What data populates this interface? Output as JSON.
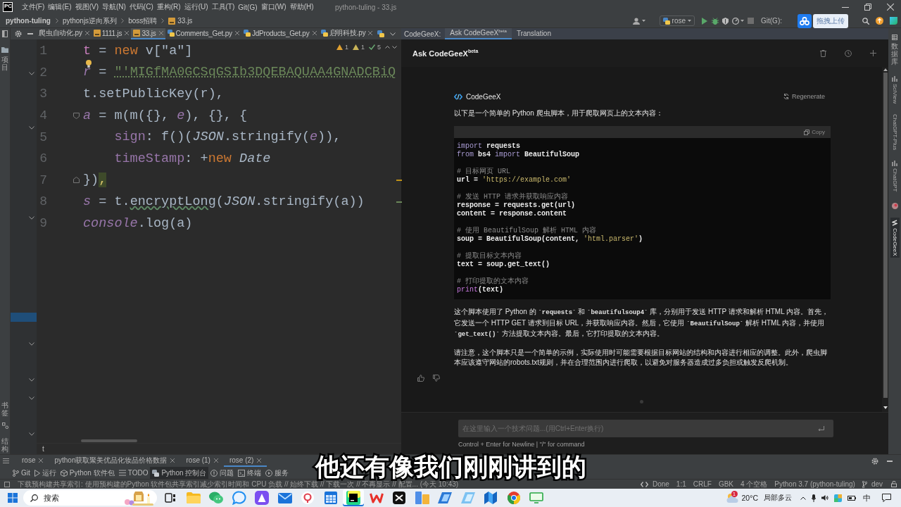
{
  "window": {
    "logo": "PC",
    "menu": [
      "文件(F)",
      "编辑(E)",
      "视图(V)",
      "导航(N)",
      "代码(C)",
      "重构(R)",
      "运行(U)",
      "工具(T)",
      "Git(G)",
      "窗口(W)",
      "帮助(H)"
    ],
    "title": "python-tuling - 33.js"
  },
  "navbar": {
    "breadcrumb": [
      {
        "kind": "project",
        "text": "python-tuling"
      },
      {
        "kind": "folder",
        "text": "pythonjs逆向系列"
      },
      {
        "kind": "folder",
        "text": "boss招聘"
      },
      {
        "kind": "file",
        "text": "33.js"
      }
    ],
    "run_config": "rose",
    "git_label": "Git(G):",
    "upload_widget": "拖拽上传"
  },
  "left_strip": {
    "top": [
      "项目"
    ],
    "bottom": [
      "书签",
      "结构"
    ]
  },
  "project_tree": [
    {
      "kind": "folder",
      "selected": false
    },
    {
      "kind": "folder",
      "selected": false
    },
    {
      "kind": "folder",
      "selected": false
    },
    {
      "kind": "file",
      "selected": true
    },
    {
      "kind": "folder",
      "selected": false
    },
    {
      "kind": "folder",
      "selected": false
    },
    {
      "kind": "folder",
      "selected": false
    },
    {
      "kind": "folder",
      "selected": false
    }
  ],
  "editor_tabs": [
    {
      "kind": "plain",
      "label": "爬虫自动化.py",
      "selected": false
    },
    {
      "kind": "js",
      "label": "1111.js",
      "selected": false
    },
    {
      "kind": "js",
      "label": "33.js",
      "selected": true
    },
    {
      "kind": "py",
      "label": "Comments_Get.py",
      "selected": false
    },
    {
      "kind": "py",
      "label": "JdProducts_Get.py",
      "selected": false
    },
    {
      "kind": "py",
      "label": "启明科技.py",
      "selected": false
    }
  ],
  "editor": {
    "inspections": [
      {
        "kind": "warning",
        "count": "1"
      },
      {
        "kind": "weak_warning",
        "count": "1"
      },
      {
        "kind": "typo",
        "count": "5"
      }
    ],
    "lines": [
      {
        "kind": "plain",
        "number": "1",
        "intention": false,
        "tokens": [
          {
            "kind": "var",
            "text": "t"
          },
          {
            "kind": "plain",
            "text": " = "
          },
          {
            "kind": "kw",
            "text": "new"
          },
          {
            "kind": "plain",
            "text": " v[\"a\"]"
          }
        ]
      },
      {
        "kind": "plain",
        "number": "2",
        "intention": true,
        "tokens": [
          {
            "kind": "ivar",
            "text": "r"
          },
          {
            "kind": "plain",
            "text": " = "
          },
          {
            "kind": "strtypo",
            "text": "\"'MIGfMA0GCSqGSIb3DQEBAQUAA4GNADCBiQ"
          }
        ]
      },
      {
        "kind": "plain",
        "number": "3",
        "intention": false,
        "tokens": [
          {
            "kind": "plain",
            "text": "t.setPublicKey(r),"
          }
        ]
      },
      {
        "kind": "fold_start",
        "number": "4",
        "intention": false,
        "tokens": [
          {
            "kind": "ivar",
            "text": "a"
          },
          {
            "kind": "plain",
            "text": " = m(m({}, "
          },
          {
            "kind": "ivar",
            "text": "e"
          },
          {
            "kind": "plain",
            "text": "), {}, {"
          }
        ]
      },
      {
        "kind": "plain",
        "number": "5",
        "intention": false,
        "tokens": [
          {
            "kind": "prop",
            "text": "    sign"
          },
          {
            "kind": "plain",
            "text": ": f()("
          },
          {
            "kind": "ital",
            "text": "JSON"
          },
          {
            "kind": "plain",
            "text": ".stringify("
          },
          {
            "kind": "ivar",
            "text": "e"
          },
          {
            "kind": "plain",
            "text": ")),"
          }
        ]
      },
      {
        "kind": "plain",
        "number": "6",
        "intention": false,
        "tokens": [
          {
            "kind": "prop",
            "text": "    timeStamp"
          },
          {
            "kind": "plain",
            "text": ": +"
          },
          {
            "kind": "kw",
            "text": "new"
          },
          {
            "kind": "ital",
            "text": " Date"
          }
        ]
      },
      {
        "kind": "fold_end",
        "number": "7",
        "intention": false,
        "tokens": [
          {
            "kind": "plain",
            "text": "})"
          },
          {
            "kind": "match",
            "text": ","
          }
        ]
      },
      {
        "kind": "plain",
        "number": "8",
        "intention": false,
        "tokens": [
          {
            "kind": "ivar",
            "text": "s"
          },
          {
            "kind": "plain",
            "text": " = t."
          },
          {
            "kind": "typo",
            "text": "encryptLong"
          },
          {
            "kind": "plain",
            "text": "("
          },
          {
            "kind": "ital",
            "text": "JSON"
          },
          {
            "kind": "plain",
            "text": ".stringify(a))"
          }
        ]
      },
      {
        "kind": "plain",
        "number": "9",
        "intention": false,
        "tokens": [
          {
            "kind": "ivar",
            "text": "console"
          },
          {
            "kind": "plain",
            "text": ".log(a)"
          }
        ]
      }
    ],
    "error_stripe": [
      {
        "kind": "warning"
      },
      {
        "kind": "typo"
      }
    ],
    "breadcrumb": "t"
  },
  "panel": {
    "title": "CodeGeeX:",
    "tabs": [
      {
        "label": "Ask CodeGeeX$^{beta}$",
        "selected": true
      },
      {
        "label": "Translation",
        "selected": false
      }
    ]
  },
  "assistant": {
    "title": "Ask CodeGeeX$^{beta}$",
    "bot_name": "CodeGeeX",
    "regenerate": "Regenerate",
    "intro": "以下是一个简单的 Python 爬虫脚本，用于爬取网页上的文本内容：",
    "copy": "Copy",
    "code": [
      [
        [
          {
            "kind": "kw",
            "text": "import"
          },
          {
            "kind": "name",
            "text": " requests"
          }
        ],
        [
          {
            "kind": "kw",
            "text": "from"
          },
          {
            "kind": "name",
            "text": " bs4 "
          },
          {
            "kind": "kw",
            "text": "import"
          },
          {
            "kind": "name",
            "text": " BeautifulSoup"
          }
        ]
      ],
      [
        [
          {
            "kind": "com",
            "text": "# 目标网页 URL"
          }
        ],
        [
          {
            "kind": "name",
            "text": "url = "
          },
          {
            "kind": "str",
            "text": "'https://example.com'"
          }
        ]
      ],
      [
        [
          {
            "kind": "com",
            "text": "# 发送 HTTP 请求并获取响应内容"
          }
        ],
        [
          {
            "kind": "name",
            "text": "response = requests.get(url)"
          }
        ],
        [
          {
            "kind": "name",
            "text": "content = response.content"
          }
        ]
      ],
      [
        [
          {
            "kind": "com",
            "text": "# 使用 BeautifulSoup 解析 HTML 内容"
          }
        ],
        [
          {
            "kind": "name",
            "text": "soup = BeautifulSoup(content, "
          },
          {
            "kind": "str",
            "text": "'html.parser'"
          },
          {
            "kind": "name",
            "text": ")"
          }
        ]
      ],
      [
        [
          {
            "kind": "com",
            "text": "# 提取目标文本内容"
          }
        ],
        [
          {
            "kind": "name",
            "text": "text = soup.get_text()"
          }
        ]
      ],
      [
        [
          {
            "kind": "com",
            "text": "# 打印提取的文本内容"
          }
        ],
        [
          {
            "kind": "fn",
            "text": "print"
          },
          {
            "kind": "name",
            "text": "(text)"
          }
        ]
      ]
    ],
    "paragraphs": [
      "这个脚本使用了 Python 的 **`requests`** 和 **`beautifulsoup4`** 库，分别用于发送 HTTP 请求和解析 HTML 内容。首先，它发送一个 HTTP GET 请求到目标 URL，并获取响应内容。然后，它使用 **`BeautifulSoup`** 解析 HTML 内容，并使用 **`get_text()`** 方法提取文本内容。最后，它打印提取的文本内容。",
      "请注意，这个脚本只是一个简单的示例，实际使用时可能需要根据目标网站的结构和内容进行相应的调整。此外，爬虫脚本应该遵守网站的robots.txt规则，并在合理范围内进行爬取，以避免对服务器造成过多负担或触发反爬机制。"
    ],
    "input_placeholder": "在这里输入一个技术问题...(用Ctrl+Enter换行)",
    "input_hint": "Control + Enter for Newline | \"/\" for command"
  },
  "right_strip": [
    {
      "kind": "database",
      "label": "数据库",
      "stacked": true,
      "selected": false
    },
    {
      "kind": "bars",
      "label": "SciView",
      "stacked": false,
      "selected": false
    },
    {
      "kind": "plain",
      "label": "ChatGPT-Plus",
      "stacked": false,
      "selected": false
    },
    {
      "kind": "bars",
      "label": "ChatGPT",
      "stacked": false,
      "selected": false
    },
    {
      "kind": "red_badge",
      "selected": false
    },
    {
      "kind": "codegeex",
      "label": "CodeGeeX",
      "stacked": false,
      "selected": true
    }
  ],
  "run_tabs": [
    {
      "label": "rose",
      "selected": false
    },
    {
      "label": "python获取聚美优品化妆品价格数据",
      "selected": false
    },
    {
      "label": "rose (1)",
      "selected": false
    },
    {
      "label": "rose (2)",
      "selected": true
    }
  ],
  "tool_windows": [
    {
      "kind": "git",
      "label": "Git",
      "selected": false
    },
    {
      "kind": "run",
      "label": "运行",
      "selected": false
    },
    {
      "kind": "packages",
      "label": "Python 软件包",
      "selected": false
    },
    {
      "kind": "todo",
      "label": "TODO",
      "selected": false
    },
    {
      "kind": "console",
      "label": "Python 控制台",
      "selected": true
    },
    {
      "kind": "problems",
      "label": "问题",
      "selected": false
    },
    {
      "kind": "terminal",
      "label": "终端",
      "selected": false
    },
    {
      "kind": "services",
      "label": "服务",
      "selected": false
    }
  ],
  "status_bar": {
    "message": "下载预构建共享索引: 使用预构建的Python 软件包共享索引减少索引时间和 CPU 负载 // 始终下载 // 下载一次 // 不再显示 // 配置... (今天 10:43)",
    "items": [
      {
        "kind": "codegeex",
        "text": "Done"
      },
      {
        "kind": "plain",
        "text": "1:1"
      },
      {
        "kind": "plain",
        "text": "CRLF"
      },
      {
        "kind": "plain",
        "text": "GBK"
      },
      {
        "kind": "plain",
        "text": "4 个空格"
      },
      {
        "kind": "plain",
        "text": "Python 3.7 (python-tuling)"
      },
      {
        "kind": "branch",
        "text": "dev"
      }
    ]
  },
  "taskbar": {
    "search_placeholder": "搜索",
    "apps": [
      {
        "kind": "taskview",
        "active": false
      },
      {
        "kind": "folder",
        "active": false
      },
      {
        "kind": "wechat",
        "active": false
      },
      {
        "kind": "chat",
        "active": false
      },
      {
        "kind": "triangle",
        "active": false
      },
      {
        "kind": "mail",
        "active": false
      },
      {
        "kind": "ring",
        "active": false
      },
      {
        "kind": "calendar",
        "active": false
      },
      {
        "kind": "ide",
        "active": true
      },
      {
        "kind": "zigzag",
        "active": false
      },
      {
        "kind": "cross",
        "active": false
      },
      {
        "kind": "files",
        "active": false
      },
      {
        "kind": "slant",
        "active": false
      },
      {
        "kind": "slant_light",
        "active": false
      },
      {
        "kind": "wave",
        "active": false
      },
      {
        "kind": "tricolor",
        "active": false
      },
      {
        "kind": "monitor",
        "active": false
      }
    ],
    "weather": {
      "badge": "1",
      "temp": "20°C",
      "text": "局部多云"
    },
    "ime": "中"
  },
  "subtitle": "他还有像我们刚刚讲到的"
}
